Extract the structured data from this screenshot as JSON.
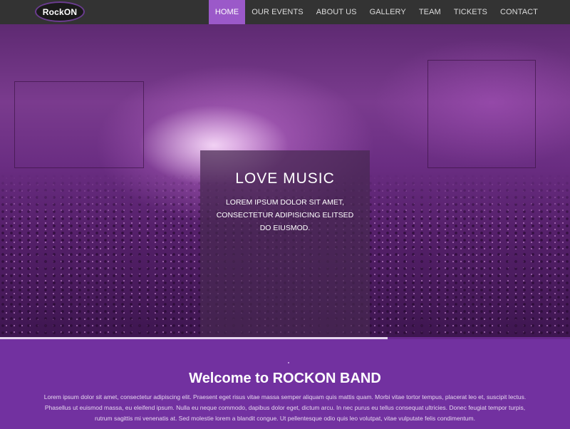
{
  "logo": {
    "text": "RockON"
  },
  "nav": {
    "items": [
      {
        "label": "HOME",
        "active": true
      },
      {
        "label": "OUR EVENTS"
      },
      {
        "label": "ABOUT US"
      },
      {
        "label": "GALLERY"
      },
      {
        "label": "TEAM"
      },
      {
        "label": "TICKETS"
      },
      {
        "label": "CONTACT"
      }
    ]
  },
  "hero": {
    "title": "LOVE MUSIC",
    "subtitle": "LOREM IPSUM DOLOR SIT AMET, CONSECTETUR ADIPISICING ELITSED DO EIUSMOD.",
    "slide_progress": 0.68
  },
  "welcome": {
    "title": "Welcome to ROCKON BAND",
    "text": "Lorem ipsum dolor sit amet, consectetur adipiscing elit. Praesent eget risus vitae massa semper aliquam quis mattis quam. Morbi vitae tortor tempus, placerat leo et, suscipit lectus. Phasellus ut euismod massa, eu eleifend ipsum. Nulla eu neque commodo, dapibus dolor eget, dictum arcu. In nec purus eu tellus consequat ultricies. Donec feugiat tempor turpis, rutrum sagittis mi venenatis at. Sed molestie lorem a blandit congue. Ut pellentesque odio quis leo volutpat, vitae vulputate felis condimentum."
  },
  "colors": {
    "nav_bg": "#333333",
    "nav_active": "#9b59c9",
    "welcome_bg": "#7231a0"
  }
}
